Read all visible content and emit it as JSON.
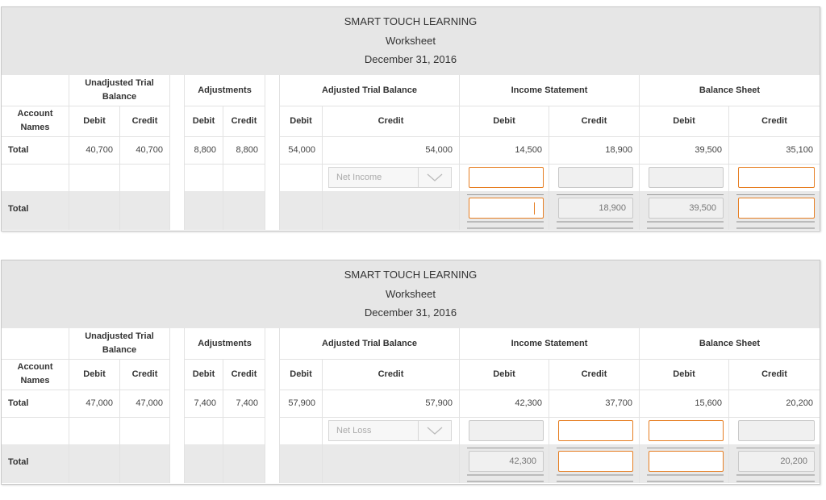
{
  "colors": {
    "accent_orange": "#e67e22",
    "header_bg": "#e6e6e6",
    "total_bg": "#e9e9e9",
    "disabled_input": "#f0f0f0"
  },
  "worksheets": [
    {
      "company": "SMART TOUCH LEARNING",
      "subtitle": "Worksheet",
      "date": "December 31, 2016",
      "sections": {
        "unadjusted": "Unadjusted Trial Balance",
        "adjustments": "Adjustments",
        "adjusted": "Adjusted Trial Balance",
        "income": "Income Statement",
        "balance": "Balance Sheet"
      },
      "columns": {
        "account_names": "Account Names",
        "debit": "Debit",
        "credit": "Credit"
      },
      "total_row": {
        "label": "Total",
        "unadj_debit": "40,700",
        "unadj_credit": "40,700",
        "adj_debit": "8,800",
        "adj_credit": "8,800",
        "atb_debit": "54,000",
        "atb_credit": "54,000",
        "is_debit": "14,500",
        "is_credit": "18,900",
        "bs_debit": "39,500",
        "bs_credit": "35,100"
      },
      "net_row": {
        "dropdown_placeholder": "Net Income",
        "is_debit": "",
        "is_credit": "",
        "bs_debit": "",
        "bs_credit": ""
      },
      "final_row": {
        "label": "Total",
        "is_debit": "",
        "is_credit": "18,900",
        "bs_debit": "39,500",
        "bs_credit": ""
      }
    },
    {
      "company": "SMART TOUCH LEARNING",
      "subtitle": "Worksheet",
      "date": "December 31, 2016",
      "sections": {
        "unadjusted": "Unadjusted Trial Balance",
        "adjustments": "Adjustments",
        "adjusted": "Adjusted Trial Balance",
        "income": "Income Statement",
        "balance": "Balance Sheet"
      },
      "columns": {
        "account_names": "Account Names",
        "debit": "Debit",
        "credit": "Credit"
      },
      "total_row": {
        "label": "Total",
        "unadj_debit": "47,000",
        "unadj_credit": "47,000",
        "adj_debit": "7,400",
        "adj_credit": "7,400",
        "atb_debit": "57,900",
        "atb_credit": "57,900",
        "is_debit": "42,300",
        "is_credit": "37,700",
        "bs_debit": "15,600",
        "bs_credit": "20,200"
      },
      "net_row": {
        "dropdown_placeholder": "Net Loss",
        "is_debit": "",
        "is_credit": "",
        "bs_debit": "",
        "bs_credit": ""
      },
      "final_row": {
        "label": "Total",
        "is_debit": "42,300",
        "is_credit": "",
        "bs_debit": "",
        "bs_credit": "20,200"
      }
    }
  ]
}
